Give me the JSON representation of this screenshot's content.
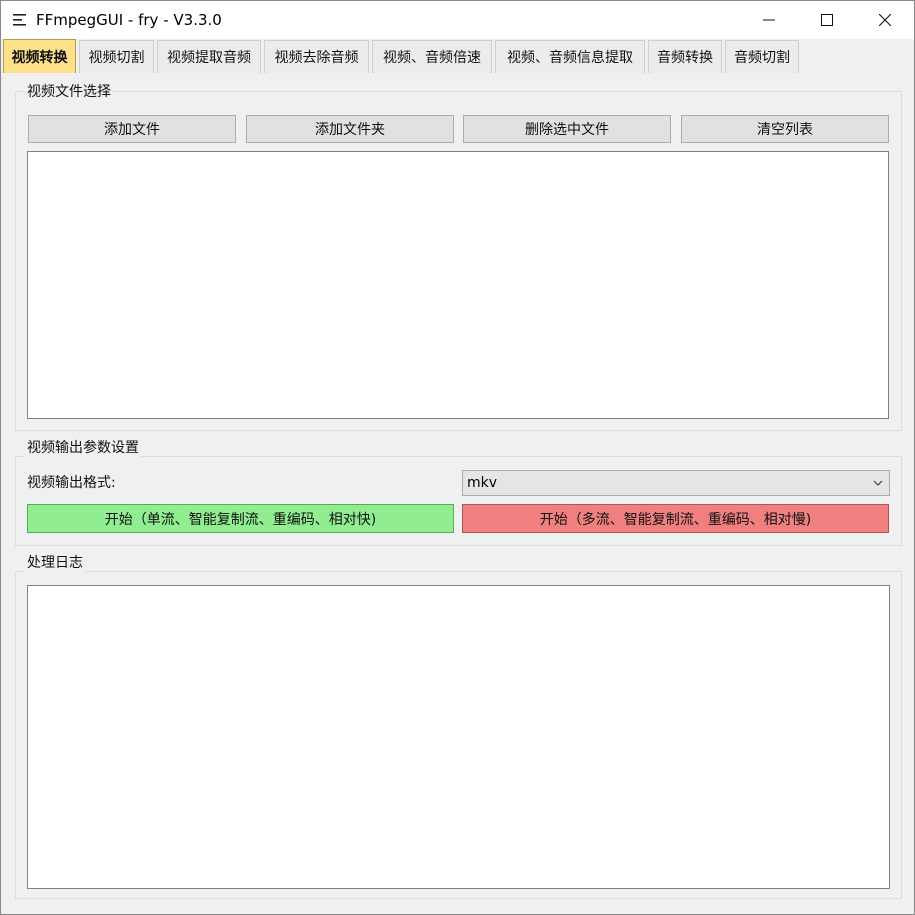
{
  "window": {
    "title": "FFmpegGUI - fry - V3.3.0",
    "icons": {
      "app": "menu-icon",
      "minimize": "minimize-icon",
      "maximize": "maximize-icon",
      "close": "close-icon"
    }
  },
  "tabs": [
    {
      "label": "视频转换",
      "active": true
    },
    {
      "label": "视频切割",
      "active": false
    },
    {
      "label": "视频提取音频",
      "active": false
    },
    {
      "label": "视频去除音频",
      "active": false
    },
    {
      "label": "视频、音频倍速",
      "active": false
    },
    {
      "label": "视频、音频信息提取",
      "active": false
    },
    {
      "label": "音频转换",
      "active": false
    },
    {
      "label": "音频切割",
      "active": false
    }
  ],
  "file_select": {
    "title": "视频文件选择",
    "add_file": "添加文件",
    "add_folder": "添加文件夹",
    "delete_selected": "删除选中文件",
    "clear_list": "清空列表"
  },
  "output_settings": {
    "title": "视频输出参数设置",
    "format_label": "视频输出格式:",
    "format_value": "mkv",
    "start_single": "开始（单流、智能复制流、重编码、相对快)",
    "start_multi": "开始（多流、智能复制流、重编码、相对慢)"
  },
  "log": {
    "title": "处理日志"
  },
  "colors": {
    "active_tab": "#ffe08a",
    "start_single_bg": "#90ee90",
    "start_multi_bg": "#f08080",
    "window_bg": "#f0f0f0"
  }
}
